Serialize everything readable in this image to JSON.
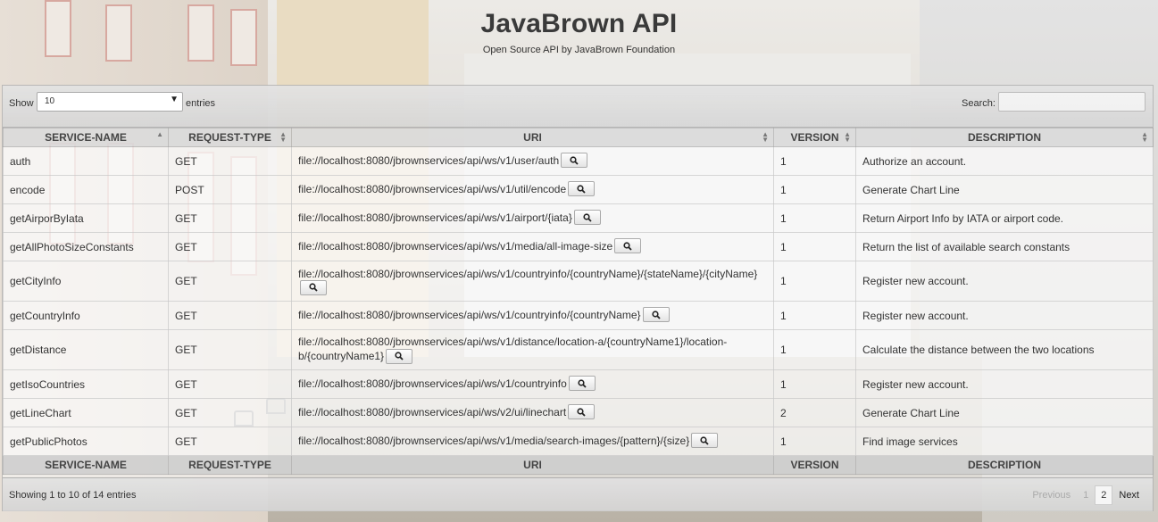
{
  "header": {
    "title": "JavaBrown API",
    "subtitle": "Open Source API by JavaBrown Foundation"
  },
  "controls": {
    "show_label": "Show",
    "entries_value": "10",
    "entries_label": "entries",
    "search_label": "Search:",
    "search_value": ""
  },
  "table": {
    "columns": [
      "SERVICE-NAME",
      "REQUEST-TYPE",
      "URI",
      "VERSION",
      "DESCRIPTION"
    ],
    "rows": [
      {
        "name": "auth",
        "type": "GET",
        "uri": "file://localhost:8080/jbrownservices/api/ws/v1/user/auth",
        "version": "1",
        "description": "Authorize an account."
      },
      {
        "name": "encode",
        "type": "POST",
        "uri": "file://localhost:8080/jbrownservices/api/ws/v1/util/encode",
        "version": "1",
        "description": "Generate Chart Line"
      },
      {
        "name": "getAirporByIata",
        "type": "GET",
        "uri": "file://localhost:8080/jbrownservices/api/ws/v1/airport/{iata}",
        "version": "1",
        "description": "Return Airport Info by IATA or airport code."
      },
      {
        "name": "getAllPhotoSizeConstants",
        "type": "GET",
        "uri": "file://localhost:8080/jbrownservices/api/ws/v1/media/all-image-size",
        "version": "1",
        "description": "Return the list of available search constants"
      },
      {
        "name": "getCityInfo",
        "type": "GET",
        "uri": "file://localhost:8080/jbrownservices/api/ws/v1/countryinfo/{countryName}/{stateName}/{cityName}",
        "version": "1",
        "description": "Register new account."
      },
      {
        "name": "getCountryInfo",
        "type": "GET",
        "uri": "file://localhost:8080/jbrownservices/api/ws/v1/countryinfo/{countryName}",
        "version": "1",
        "description": "Register new account."
      },
      {
        "name": "getDistance",
        "type": "GET",
        "uri": "file://localhost:8080/jbrownservices/api/ws/v1/distance/location-a/{countryName1}/location-b/{countryName1}",
        "version": "1",
        "description": "Calculate the distance between the two locations"
      },
      {
        "name": "getIsoCountries",
        "type": "GET",
        "uri": "file://localhost:8080/jbrownservices/api/ws/v1/countryinfo",
        "version": "1",
        "description": "Register new account."
      },
      {
        "name": "getLineChart",
        "type": "GET",
        "uri": "file://localhost:8080/jbrownservices/api/ws/v2/ui/linechart",
        "version": "2",
        "description": "Generate Chart Line"
      },
      {
        "name": "getPublicPhotos",
        "type": "GET",
        "uri": "file://localhost:8080/jbrownservices/api/ws/v1/media/search-images/{pattern}/{size}",
        "version": "1",
        "description": "Find image services"
      }
    ]
  },
  "footer": {
    "info": "Showing 1 to 10 of 14 entries",
    "pagination": {
      "previous": "Previous",
      "page1": "1",
      "page2": "2",
      "next": "Next"
    }
  }
}
